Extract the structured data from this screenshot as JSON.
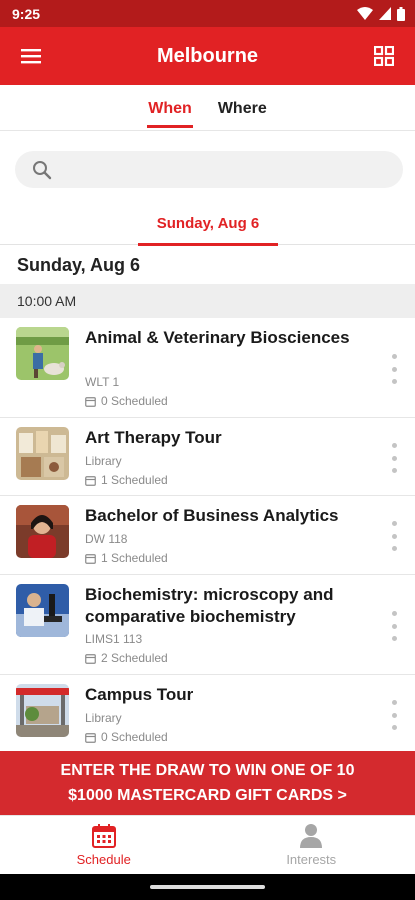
{
  "status_bar": {
    "time": "9:25"
  },
  "app_bar": {
    "title": "Melbourne"
  },
  "segment_tabs": [
    {
      "label": "When",
      "active": true
    },
    {
      "label": "Where",
      "active": false
    }
  ],
  "search": {
    "placeholder": "",
    "value": ""
  },
  "date_tab": {
    "label": "Sunday, Aug 6"
  },
  "day_heading": "Sunday, Aug 6",
  "time_slot": "10:00 AM",
  "sessions": [
    {
      "title": "Animal & Veterinary Biosciences",
      "location": "WLT 1",
      "scheduled": "0 Scheduled"
    },
    {
      "title": "Art Therapy Tour",
      "location": "Library",
      "scheduled": "1 Scheduled"
    },
    {
      "title": "Bachelor of Business Analytics",
      "location": "DW 118",
      "scheduled": "1 Scheduled"
    },
    {
      "title": "Biochemistry: microscopy and comparative biochemistry",
      "location": "LIMS1 113",
      "scheduled": "2 Scheduled"
    },
    {
      "title": "Campus Tour",
      "location": "Library",
      "scheduled": "0 Scheduled"
    }
  ],
  "banner": {
    "line1": "ENTER THE DRAW TO WIN ONE OF 10",
    "line2": "$1000 MASTERCARD GIFT CARDS >"
  },
  "bottom_nav": [
    {
      "label": "Schedule",
      "icon": "calendar-icon",
      "active": true
    },
    {
      "label": "Interests",
      "icon": "person-icon",
      "active": false
    }
  ],
  "colors": {
    "brand_red": "#e12224",
    "status_red": "#b31b1b",
    "banner_red": "#d42a2e"
  }
}
